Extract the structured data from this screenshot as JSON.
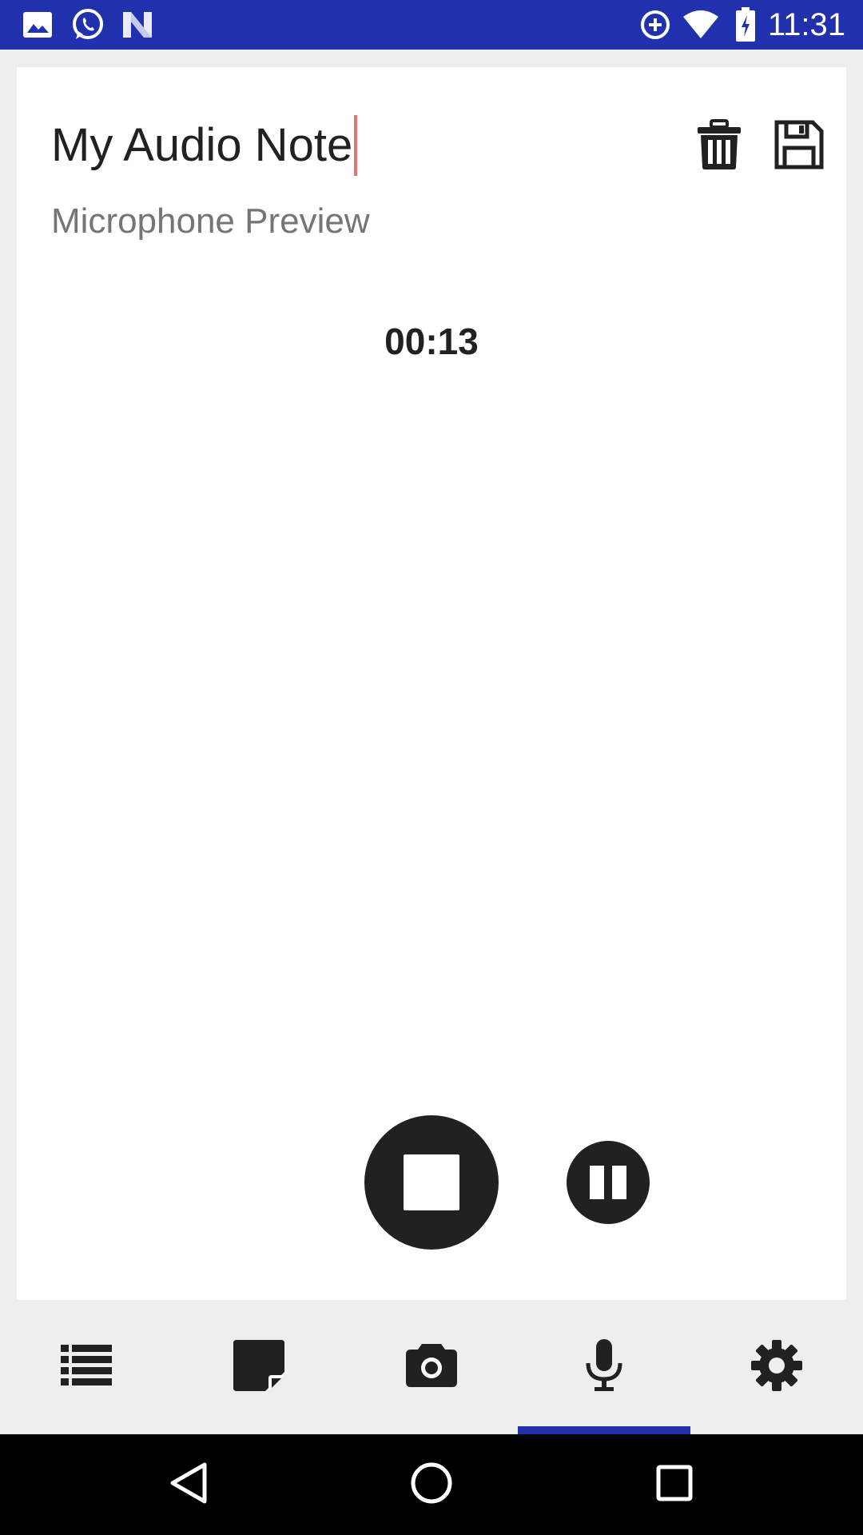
{
  "status_bar": {
    "time": "11:31",
    "icons": [
      "image-icon",
      "whatsapp-icon",
      "n-app-icon",
      "data-saver-icon",
      "wifi-icon",
      "battery-charging-icon"
    ]
  },
  "note": {
    "title_value": "My Audio Note",
    "subtitle": "Microphone Preview",
    "timer": "00:13"
  },
  "actions": {
    "delete_icon": "trash-icon",
    "save_icon": "floppy-save-icon",
    "stop_icon": "stop-icon",
    "pause_icon": "pause-icon"
  },
  "bottom_nav": {
    "items": [
      "list-icon",
      "note-icon",
      "camera-icon",
      "microphone-icon",
      "settings-icon"
    ],
    "active_index": 3,
    "accent_color": "#2130ad"
  },
  "system_nav": [
    "back-icon",
    "home-icon",
    "recents-icon"
  ]
}
